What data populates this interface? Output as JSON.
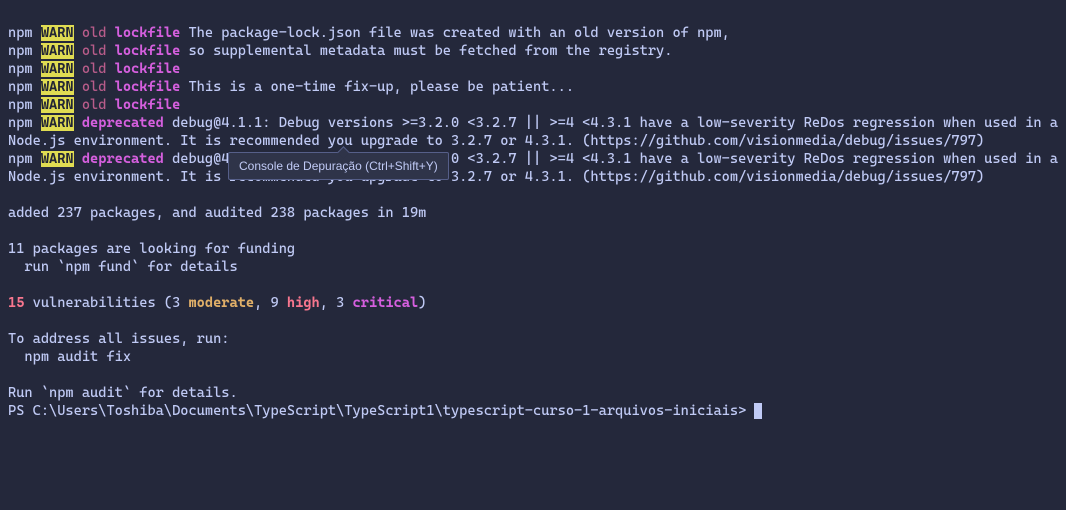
{
  "warn_lines": [
    {
      "tag_a": "old",
      "tag_b": "lockfile",
      "msg": "The package-lock.json file was created with an old version of npm,"
    },
    {
      "tag_a": "old",
      "tag_b": "lockfile",
      "msg": "so supplemental metadata must be fetched from the registry."
    },
    {
      "tag_a": "old",
      "tag_b": "lockfile",
      "msg": ""
    },
    {
      "tag_a": "old",
      "tag_b": "lockfile",
      "msg": "This is a one-time fix-up, please be patient..."
    },
    {
      "tag_a": "old",
      "tag_b": "lockfile",
      "msg": ""
    }
  ],
  "deprecated_a": {
    "tag": "deprecated",
    "msg": "debug@4.1.1: Debug versions >=3.2.0 <3.2.7 || >=4 <4.3.1 have a low-severity ReDos regression when used in a Node.js environment. It is recommended you upgrade to 3.2.7 or 4.3.1. (https://github.com/visionmedia/debug/issues/797)"
  },
  "deprecated_b": {
    "tag": "deprecated",
    "msg": "debug@4.1.1: Debug versions >=3.2.0 <3.2.7 || >=4 <4.3.1 have a low-severity ReDos regression when used in a Node.js environment. It is recommended you upgrade to 3.2.7 or 4.3.1. (https://github.com/visionmedia/debug/issues/797)"
  },
  "summary": {
    "added": "added 237 packages, and audited 238 packages in 19m",
    "funding_a": "11 packages are looking for funding",
    "funding_b": "  run `npm fund` for details",
    "vuln_count": "15",
    "vuln_text_a": " vulnerabilities (3 ",
    "moderate": "moderate",
    "vuln_text_b": ", 9 ",
    "high": "high",
    "vuln_text_c": ", 3 ",
    "critical": "critical",
    "vuln_text_d": ")",
    "address_a": "To address all issues, run:",
    "address_b": "  npm audit fix",
    "audit": "Run `npm audit` for details."
  },
  "prompt": "PS C:\\Users\\Toshiba\\Documents\\TypeScript\\TypeScript1\\typescript-curso-1-arquivos-iniciais> ",
  "tooltip": "Console de Depuração (Ctrl+Shift+Y)",
  "npm_label": "npm",
  "warn_label": "WARN"
}
